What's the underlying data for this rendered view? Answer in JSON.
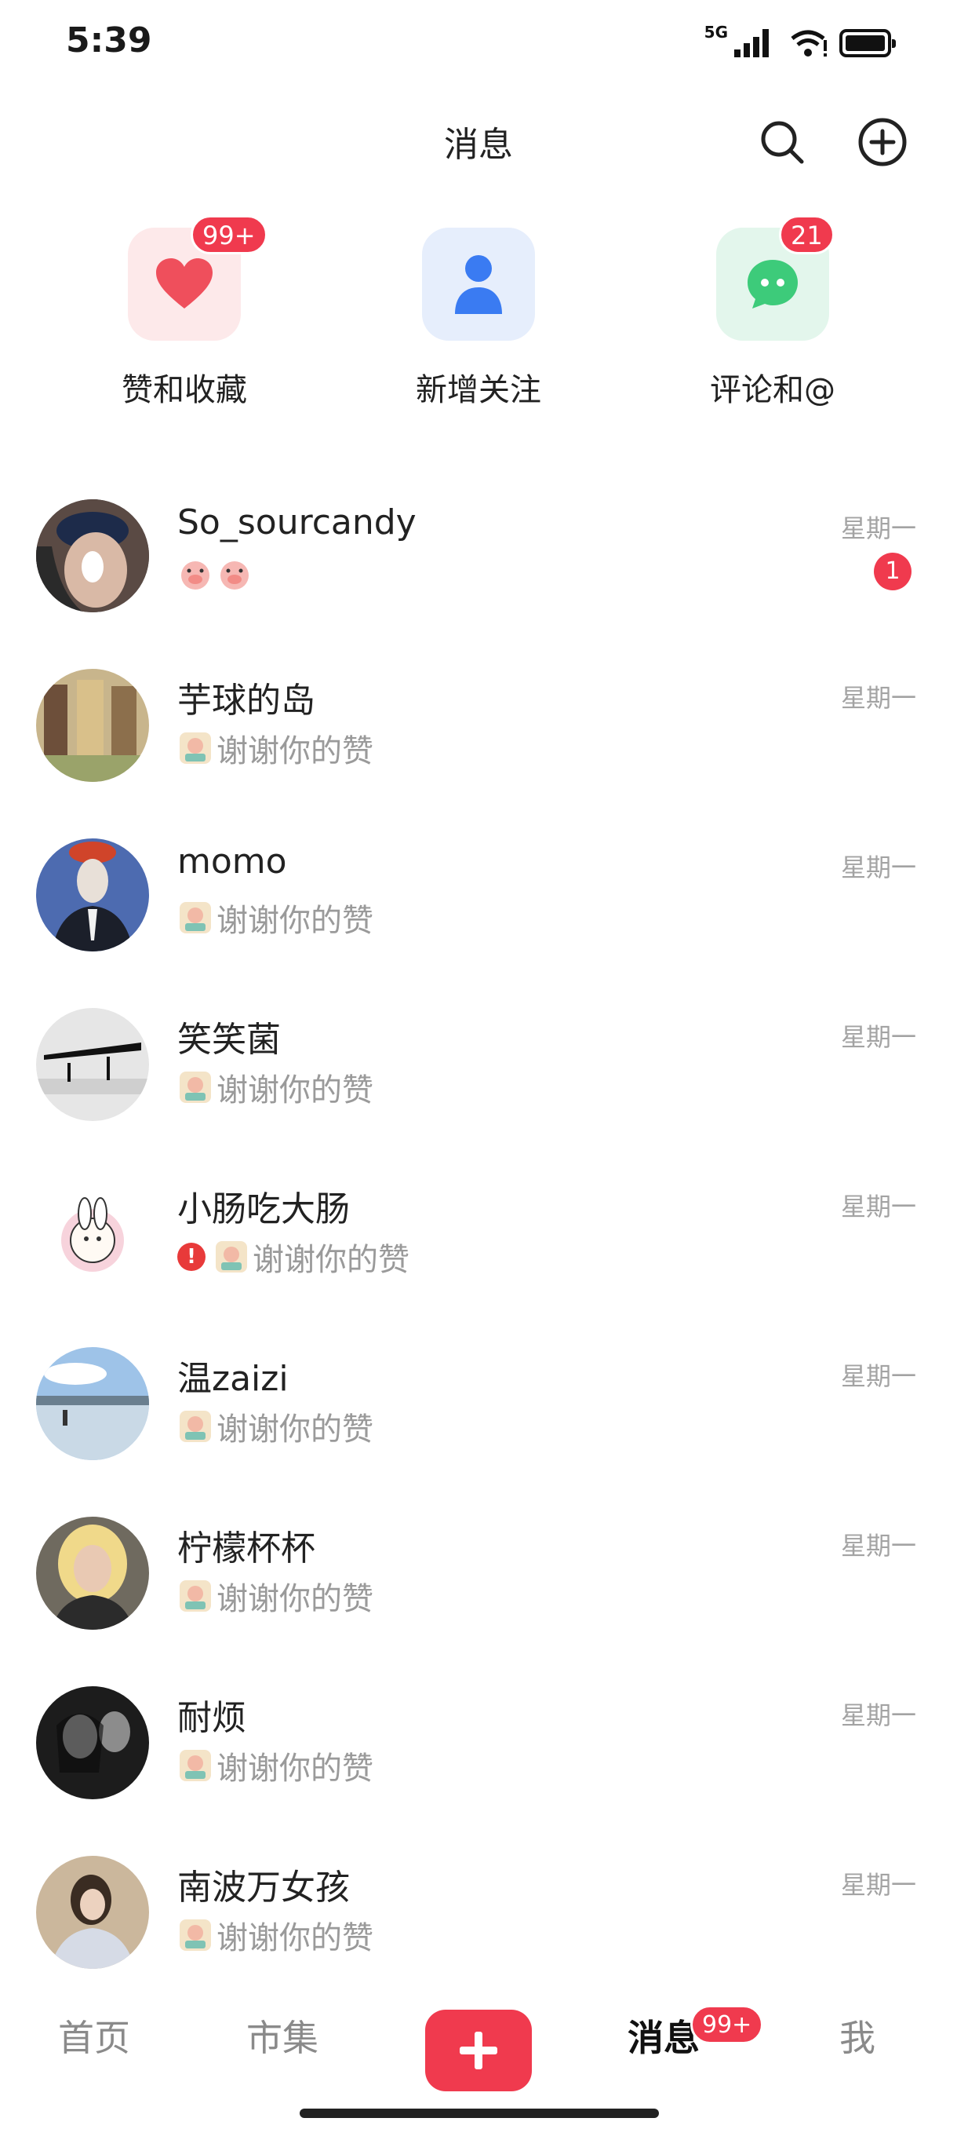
{
  "status": {
    "time": "5:39",
    "network": "5G"
  },
  "header": {
    "title": "消息",
    "search_icon": "search-icon",
    "add_icon": "add-circle-icon"
  },
  "categories": [
    {
      "label": "赞和收藏",
      "badge": "99+",
      "icon": "heart-icon",
      "color": "#ef4f5c"
    },
    {
      "label": "新增关注",
      "badge": "",
      "icon": "person-icon",
      "color": "#3a7bf2"
    },
    {
      "label": "评论和@",
      "badge": "21",
      "icon": "chat-bubble-icon",
      "color": "#3dcb7a"
    }
  ],
  "messages": [
    {
      "name": "So_sourcandy",
      "preview": "",
      "time": "星期一",
      "unread": "1",
      "avatar_color": "#3b3b3b"
    },
    {
      "name": "芋球的岛",
      "preview": "谢谢你的赞",
      "time": "星期一",
      "unread": "",
      "avatar_color": "#b7a074"
    },
    {
      "name": "momo",
      "preview": "谢谢你的赞",
      "time": "星期一",
      "unread": "",
      "avatar_color": "#3f5f9f"
    },
    {
      "name": "笑笑菌",
      "preview": "谢谢你的赞",
      "time": "星期一",
      "unread": "",
      "avatar_color": "#d9d9d9"
    },
    {
      "name": "小肠吃大肠",
      "preview": "谢谢你的赞",
      "time": "星期一",
      "unread": "",
      "avatar_color": "#ffffff"
    },
    {
      "name": "温zaizi",
      "preview": "谢谢你的赞",
      "time": "星期一",
      "unread": "",
      "avatar_color": "#6c97c6"
    },
    {
      "name": "柠檬杯杯",
      "preview": "谢谢你的赞",
      "time": "星期一",
      "unread": "",
      "avatar_color": "#8c7a5c"
    },
    {
      "name": "耐烦",
      "preview": "谢谢你的赞",
      "time": "星期一",
      "unread": "",
      "avatar_color": "#222222"
    },
    {
      "name": "南波万女孩",
      "preview": "谢谢你的赞",
      "time": "星期一",
      "unread": "",
      "avatar_color": "#a89b8a"
    }
  ],
  "tabbar": {
    "home": "首页",
    "market": "市集",
    "messages": "消息",
    "messages_badge": "99+",
    "me": "我"
  },
  "colors": {
    "accent": "#f03a4e"
  }
}
